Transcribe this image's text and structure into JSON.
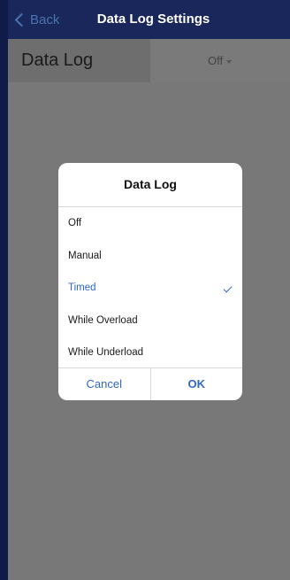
{
  "nav": {
    "back_label": "Back",
    "title": "Data Log Settings"
  },
  "setting": {
    "label": "Data Log",
    "value": "Off"
  },
  "dialog": {
    "title": "Data Log",
    "options": [
      "Off",
      "Manual",
      "Timed",
      "While Overload",
      "While Underload"
    ],
    "selected": "Timed",
    "cancel_label": "Cancel",
    "ok_label": "OK"
  },
  "colors": {
    "accent": "#2f66c9",
    "navbar": "#19275a",
    "overlay": "#787878"
  }
}
